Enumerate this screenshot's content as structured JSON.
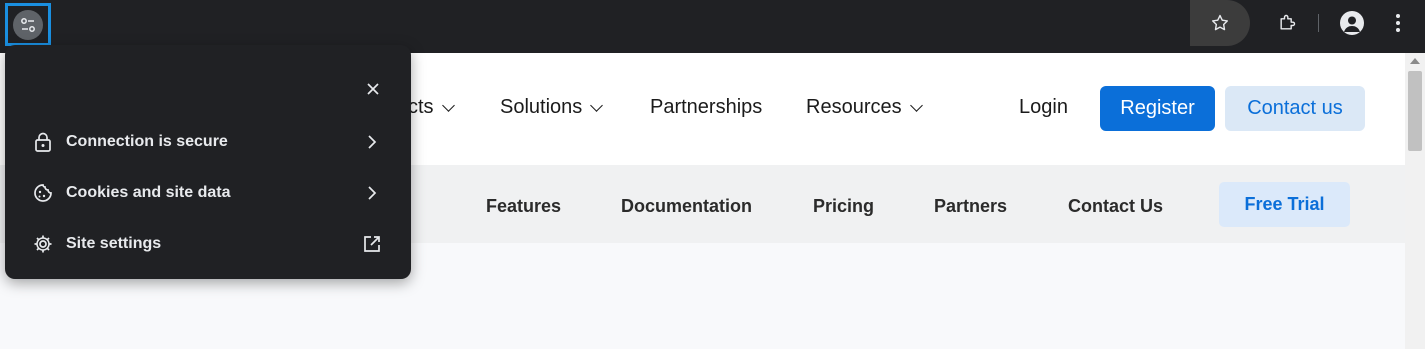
{
  "browser": {
    "site_info_icon": "site-info-tune-icon",
    "toolbar_icons": [
      "star-icon",
      "extensions-icon",
      "profile-avatar-icon",
      "more-menu-icon"
    ]
  },
  "popup": {
    "close_icon": "close-icon",
    "rows": [
      {
        "label": "Connection is secure",
        "icon": "lock-icon",
        "end_icon": "chevron-right-icon"
      },
      {
        "label": "Cookies and site data",
        "icon": "cookie-icon",
        "end_icon": "chevron-right-icon"
      },
      {
        "label": "Site settings",
        "icon": "gear-icon",
        "end_icon": "open-in-new-icon"
      }
    ]
  },
  "navbar": {
    "products_partial": "cts",
    "solutions": "Solutions",
    "partnerships": "Partnerships",
    "resources": "Resources",
    "login": "Login",
    "register": "Register",
    "contact": "Contact us"
  },
  "subnav": {
    "features": "Features",
    "documentation": "Documentation",
    "pricing": "Pricing",
    "partners": "Partners",
    "contact_us": "Contact Us",
    "free_trial": "Free Trial"
  },
  "colors": {
    "accent": "#0b6fd9",
    "chrome_dark": "#202124",
    "highlight_border": "#1a8fe0"
  }
}
